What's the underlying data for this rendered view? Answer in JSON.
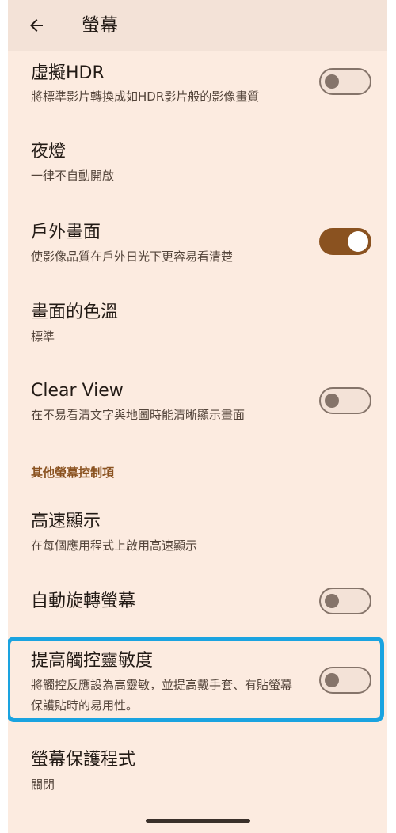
{
  "app_bar": {
    "title": "螢幕",
    "back_icon": "arrow-left-icon"
  },
  "settings": [
    {
      "id": "hdr",
      "title": "虛擬HDR",
      "subtitle": "將標準影片轉換成如HDR影片般的影像畫質",
      "toggle": "off"
    },
    {
      "id": "night-light",
      "title": "夜燈",
      "subtitle": "一律不自動開啟"
    },
    {
      "id": "outdoor",
      "title": "戶外畫面",
      "subtitle": "使影像品質在戶外日光下更容易看清楚",
      "toggle": "on"
    },
    {
      "id": "color-temp",
      "title": "畫面的色溫",
      "subtitle": "標準"
    },
    {
      "id": "clear-view",
      "title": "Clear View",
      "subtitle": "在不易看清文字與地圖時能清晰顯示畫面",
      "toggle": "off"
    }
  ],
  "section_header": "其他螢幕控制項",
  "settings_other": [
    {
      "id": "high-speed",
      "title": "高速顯示",
      "subtitle": "在每個應用程式上啟用高速顯示"
    },
    {
      "id": "auto-rotate",
      "title": "自動旋轉螢幕",
      "toggle": "off"
    },
    {
      "id": "touch-sensitivity",
      "title": "提高觸控靈敏度",
      "subtitle": "將觸控反應設為高靈敏，並提高戴手套、有貼螢幕保護貼時的易用性。",
      "toggle": "off"
    },
    {
      "id": "screensaver",
      "title": "螢幕保護程式",
      "subtitle": "關閉"
    }
  ],
  "colors": {
    "background": "#fcebe0",
    "app_bar": "#f3e2d7",
    "accent": "#8a5220",
    "highlight_border": "#1aa3e0"
  }
}
